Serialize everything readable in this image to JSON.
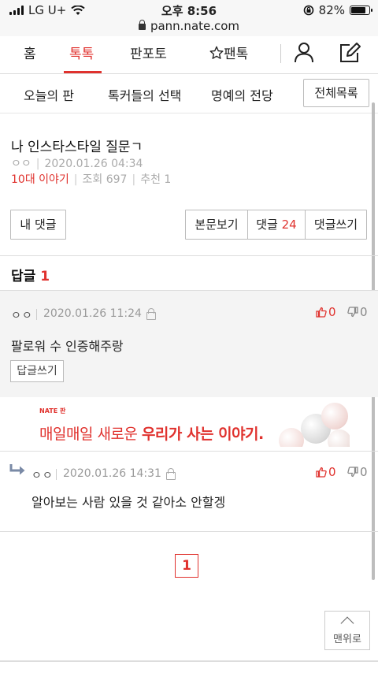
{
  "status_bar": {
    "carrier": "LG U+",
    "time": "오후 8:56",
    "battery": "82%"
  },
  "url_bar": {
    "url": "pann.nate.com"
  },
  "top_nav": {
    "tabs": [
      {
        "label": "홈"
      },
      {
        "label": "톡톡"
      },
      {
        "label": "판포토"
      },
      {
        "label": "팬톡"
      }
    ],
    "active_tab": "톡톡"
  },
  "sub_nav": {
    "items": [
      {
        "label": "오늘의 판"
      },
      {
        "label": "톡커들의 선택"
      },
      {
        "label": "명예의 전당"
      }
    ],
    "all_list_label": "전체목록"
  },
  "post": {
    "title": "나 인스타스타일 질문ㄱ",
    "author": "ㅇㅇ",
    "datetime": "2020.01.26 04:34",
    "category": "10대 이야기",
    "views_label": "조회",
    "views": "697",
    "recommend_label": "추천",
    "recommend": "1"
  },
  "actions": {
    "my_comments": "내 댓글",
    "view_post": "본문보기",
    "comments_label": "댓글",
    "comments_count": "24",
    "write_comment": "댓글쓰기"
  },
  "replies": {
    "heading": "답글",
    "count": "1"
  },
  "comment": {
    "author": "ㅇㅇ",
    "datetime": "2020.01.26 11:24",
    "text": "팔로워 수 인증해주랑",
    "up": "0",
    "down": "0",
    "reply_button": "답글쓰기"
  },
  "ad": {
    "brand": "NATE 판",
    "text_normal": "매일매일 새로운 ",
    "text_bold": "우리가 사는 이야기."
  },
  "reply": {
    "author": "ㅇㅇ",
    "datetime": "2020.01.26 14:31",
    "text": "알아보는 사람 있을 것 같아소 안할겡",
    "up": "0",
    "down": "0"
  },
  "pagination": {
    "current": "1"
  },
  "to_top": {
    "label": "맨위로"
  },
  "colors": {
    "accent": "#e0322e",
    "divider": "#dddddd",
    "band": "#f4f4f4"
  }
}
